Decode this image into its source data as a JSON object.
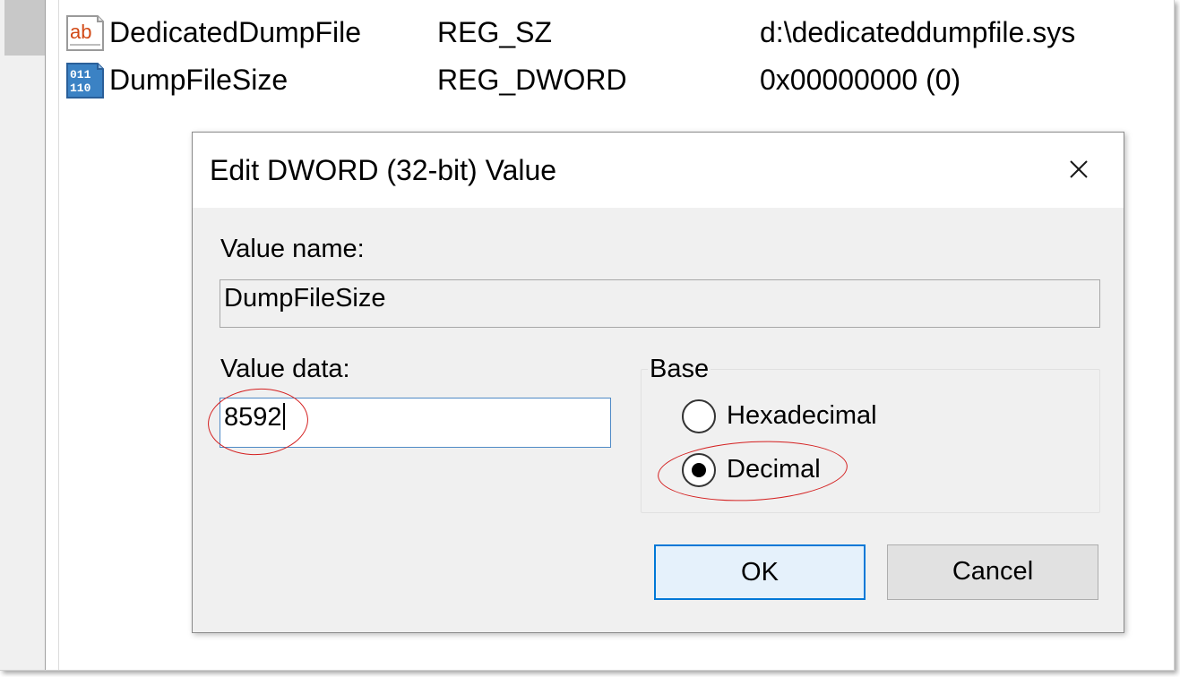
{
  "registry_list": {
    "rows": [
      {
        "icon": "string-value-icon",
        "icon_text": "ab",
        "name": "DedicatedDumpFile",
        "type": "REG_SZ",
        "data": "d:\\dedicateddumpfile.sys"
      },
      {
        "icon": "binary-value-icon",
        "icon_text_top": "011",
        "icon_text_bottom": "110",
        "name": "DumpFileSize",
        "type": "REG_DWORD",
        "data": "0x00000000 (0)"
      }
    ]
  },
  "dialog": {
    "title": "Edit DWORD (32-bit) Value",
    "close_icon": "close-icon",
    "value_name_label": "Value name:",
    "value_name": "DumpFileSize",
    "value_data_label": "Value data:",
    "value_data": "8592",
    "base_label": "Base",
    "base_options": [
      {
        "label": "Hexadecimal",
        "selected": false
      },
      {
        "label": "Decimal",
        "selected": true
      }
    ],
    "ok_label": "OK",
    "cancel_label": "Cancel"
  },
  "colors": {
    "annotation": "#d42020",
    "focus_border": "#0078d7",
    "dialog_bg": "#f0f0f0"
  }
}
